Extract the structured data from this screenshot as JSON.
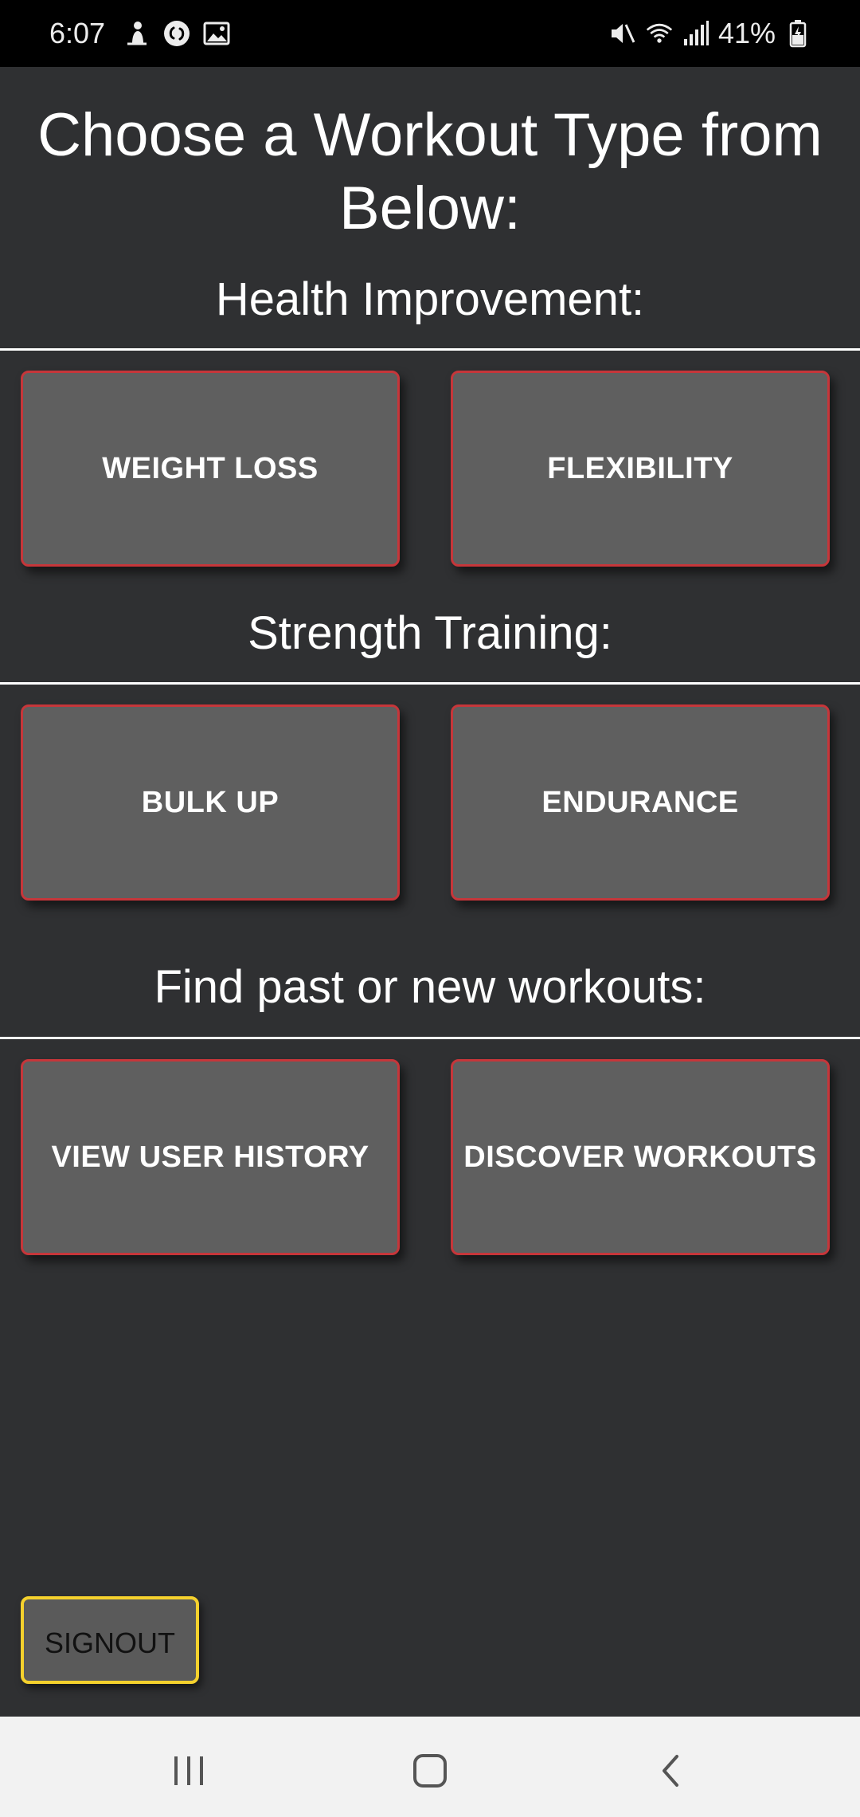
{
  "status_bar": {
    "time": "6:07",
    "left_icons": [
      "notification-person-icon",
      "shazam-icon",
      "gallery-image-icon"
    ],
    "right_icons": [
      "mute-vibrate-icon",
      "wifi-icon",
      "signal-icon",
      "battery-charging-icon"
    ],
    "battery_percent": "41%"
  },
  "page": {
    "title": "Choose a Workout Type from Below:"
  },
  "sections": [
    {
      "heading": "Health Improvement:",
      "buttons": [
        "WEIGHT LOSS",
        "FLEXIBILITY"
      ]
    },
    {
      "heading": "Strength Training:",
      "buttons": [
        "BULK UP",
        "ENDURANCE"
      ]
    },
    {
      "heading": "Find past or new workouts:",
      "buttons": [
        "VIEW USER HISTORY",
        "DISCOVER WORKOUTS"
      ]
    }
  ],
  "signout": {
    "label": "SIGNOUT"
  },
  "nav_bar": {
    "buttons": [
      "recent-apps-icon",
      "home-icon",
      "back-icon"
    ]
  },
  "colors": {
    "background": "#2f3032",
    "tile": "#5f5f5f",
    "tile_border": "#c6363a",
    "signout_border": "#f5d12d",
    "nav_bar": "#f2f2f2"
  }
}
